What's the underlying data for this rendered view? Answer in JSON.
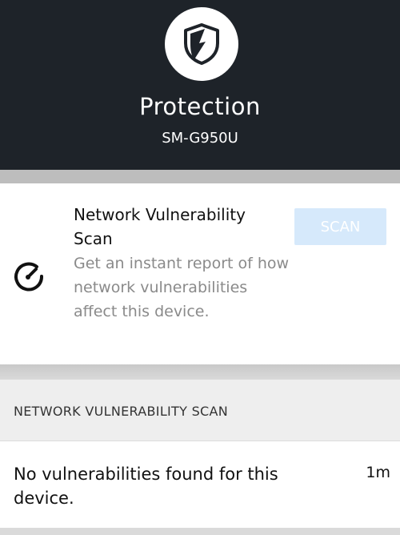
{
  "header": {
    "title": "Protection",
    "device": "SM-G950U",
    "logo_icon": "shield-icon",
    "background": "#1e2329"
  },
  "scan_card": {
    "icon": "gauge-icon",
    "title": "Network Vulnerability Scan",
    "description": "Get an instant report of how network vulnerabilities affect this device.",
    "scan_button": "SCAN",
    "scan_button_color": "#d6e9fb"
  },
  "results_section": {
    "header": "NETWORK VULNERABILITY SCAN",
    "items": [
      {
        "text": "No vulnerabilities found for this device.",
        "time": "1m"
      }
    ]
  }
}
